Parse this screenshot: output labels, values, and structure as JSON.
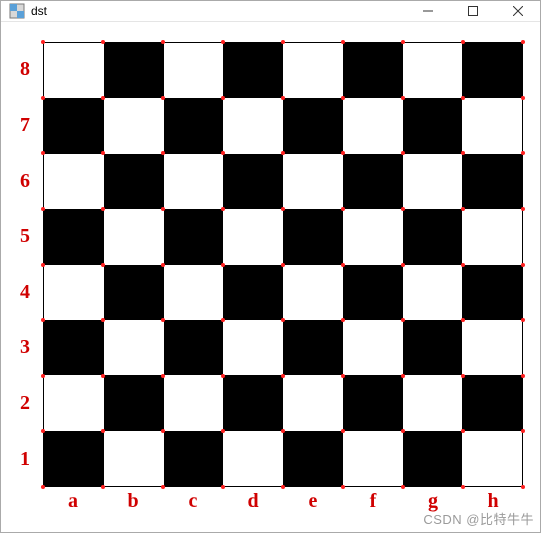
{
  "window": {
    "title": "dst"
  },
  "board": {
    "ranks": [
      "8",
      "7",
      "6",
      "5",
      "4",
      "3",
      "2",
      "1"
    ],
    "files": [
      "a",
      "b",
      "c",
      "d",
      "e",
      "f",
      "g",
      "h"
    ],
    "size": 8,
    "corner_detection": true
  },
  "watermark": "CSDN @比特牛牛"
}
